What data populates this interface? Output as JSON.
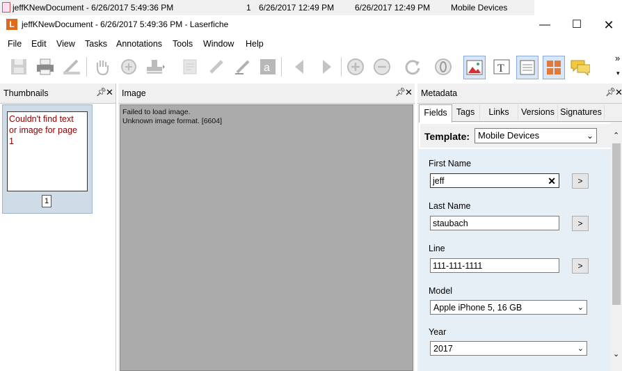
{
  "background_row": {
    "name": "jeffKNewDocument - 6/26/2017 5:49:36 PM",
    "col1": "1",
    "col2": "6/26/2017 12:49 PM",
    "col3": "6/26/2017 12:49 PM",
    "col4": "Mobile Devices"
  },
  "window": {
    "title": "jeffKNewDocument - 6/26/2017 5:49:36 PM - Laserfiche",
    "logo_letter": "L",
    "accent": "#e06a1c"
  },
  "menu": [
    "File",
    "Edit",
    "View",
    "Tasks",
    "Annotations",
    "Tools",
    "Window",
    "Help"
  ],
  "toolbar_overflow": "»",
  "thumbnails": {
    "title": "Thumbnails",
    "error": "Couldn't find text or image for page 1",
    "page_number": "1"
  },
  "image": {
    "title": "Image",
    "error_line1": "Failed to load image.",
    "error_line2": "Unknown image format. [6604]"
  },
  "metadata": {
    "title": "Metadata",
    "tabs": [
      "Fields",
      "Tags",
      "Links",
      "Versions",
      "Signatures"
    ],
    "template_label": "Template:",
    "template_value": "Mobile Devices",
    "fields": {
      "first_name_label": "First Name",
      "first_name_value": "jeff",
      "last_name_label": "Last Name",
      "last_name_value": "staubach",
      "line_label": "Line",
      "line_value": "111-111-1111",
      "model_label": "Model",
      "model_value": "Apple iPhone 5, 16 GB",
      "year_label": "Year",
      "year_value": "2017"
    },
    "go_button": ">"
  }
}
